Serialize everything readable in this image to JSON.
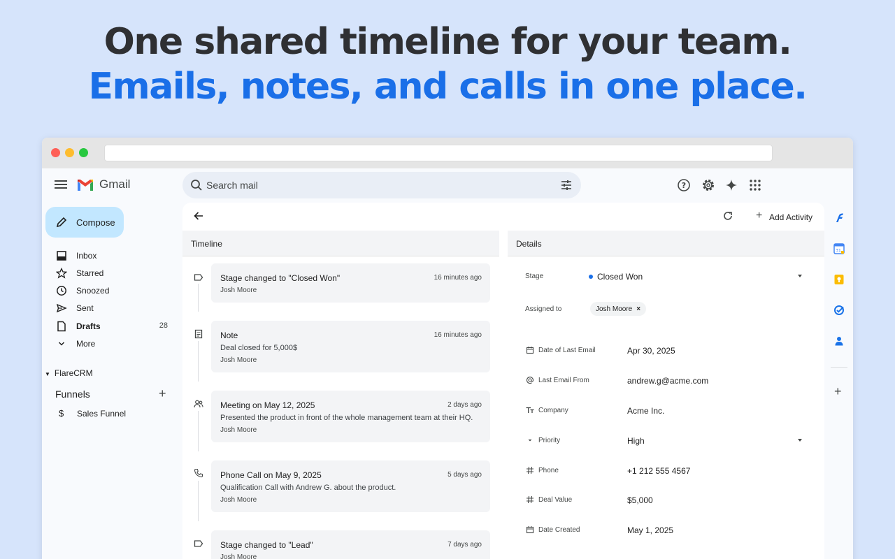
{
  "hero": {
    "line1": "One shared timeline for your team.",
    "line2": "Emails, notes, and calls in one place."
  },
  "colors": {
    "background": "#d6e4fb",
    "accent": "#1a6fe8",
    "compose": "#c2e7ff"
  },
  "header": {
    "brand": "Gmail",
    "search_placeholder": "Search mail",
    "icons": [
      "help-icon",
      "settings-icon",
      "gemini-sparkle-icon",
      "apps-grid-icon"
    ]
  },
  "sidebar": {
    "compose": "Compose",
    "items": [
      {
        "label": "Inbox",
        "icon": "inbox-icon",
        "count": ""
      },
      {
        "label": "Starred",
        "icon": "star-icon",
        "count": ""
      },
      {
        "label": "Snoozed",
        "icon": "clock-icon",
        "count": ""
      },
      {
        "label": "Sent",
        "icon": "send-icon",
        "count": ""
      },
      {
        "label": "Drafts",
        "icon": "draft-icon",
        "count": "28"
      },
      {
        "label": "More",
        "icon": "chevron-down-icon",
        "count": ""
      }
    ],
    "crm_section": "FlareCRM",
    "funnels_title": "Funnels",
    "funnels": [
      {
        "label": "Sales Funnel",
        "icon": "$"
      }
    ]
  },
  "toolbar": {
    "add_activity": "Add Activity"
  },
  "timeline": {
    "heading": "Timeline",
    "entries": [
      {
        "icon": "label-icon",
        "title": "Stage changed to \"Closed Won\"",
        "time": "16 minutes ago",
        "body": "",
        "author": "Josh Moore"
      },
      {
        "icon": "note-icon",
        "title": "Note",
        "time": "16 minutes ago",
        "body": "Deal closed for 5,000$",
        "author": "Josh Moore"
      },
      {
        "icon": "meeting-icon",
        "title": "Meeting on May 12, 2025",
        "time": "2 days ago",
        "body": "Presented the product in front of the whole management team at their HQ.",
        "author": "Josh Moore"
      },
      {
        "icon": "phone-icon",
        "title": "Phone Call on May 9, 2025",
        "time": "5 days ago",
        "body": "Qualification Call with Andrew G. about the product.",
        "author": "Josh Moore"
      },
      {
        "icon": "label-icon",
        "title": "Stage changed to \"Lead\"",
        "time": "7 days ago",
        "body": "",
        "author": "Josh Moore"
      }
    ]
  },
  "details": {
    "heading": "Details",
    "stage_label": "Stage",
    "stage_value": "Closed Won",
    "assigned_label": "Assigned to",
    "assigned_value": "Josh Moore",
    "fields": [
      {
        "icon": "calendar-icon",
        "label": "Date of Last Email",
        "value": "Apr 30, 2025"
      },
      {
        "icon": "at-icon",
        "label": "Last Email From",
        "value": "andrew.g@acme.com"
      },
      {
        "icon": "text-icon",
        "label": "Company",
        "value": "Acme Inc."
      },
      {
        "icon": "caret-icon",
        "label": "Priority",
        "value": "High"
      },
      {
        "icon": "hash-icon",
        "label": "Phone",
        "value": "+1 212 555 4567"
      },
      {
        "icon": "hash-icon",
        "label": "Deal Value",
        "value": "$5,000"
      },
      {
        "icon": "calendar-icon",
        "label": "Date Created",
        "value": "May 1, 2025"
      }
    ]
  },
  "rail": {
    "icons": [
      "flarecrm-icon",
      "calendar-app-icon",
      "keep-icon",
      "tasks-icon",
      "contacts-icon"
    ]
  }
}
